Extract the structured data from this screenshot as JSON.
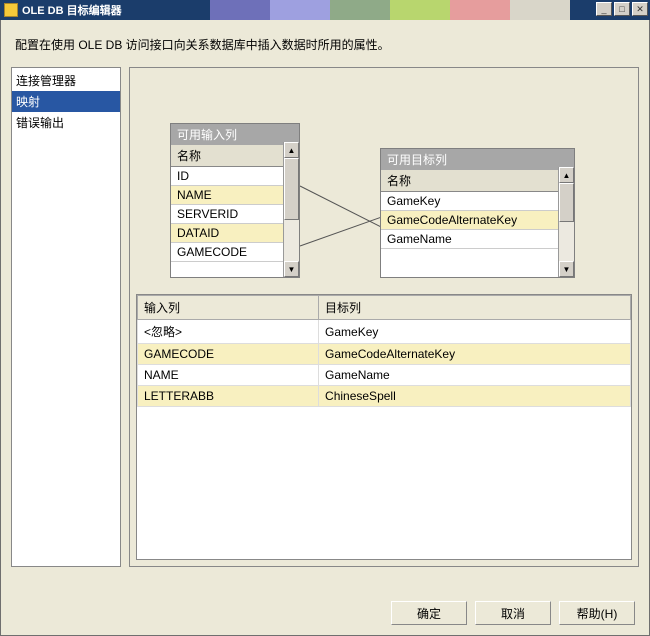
{
  "window": {
    "title": "OLE DB 目标编辑器"
  },
  "description": "配置在使用 OLE DB 访问接口向关系数据库中插入数据时所用的属性。",
  "nav": {
    "items": [
      {
        "label": "连接管理器",
        "selected": false
      },
      {
        "label": "映射",
        "selected": true
      },
      {
        "label": "错误输出",
        "selected": false
      }
    ]
  },
  "input_box": {
    "title": "可用输入列",
    "header": "名称",
    "rows": [
      {
        "label": "ID",
        "hl": false
      },
      {
        "label": "NAME",
        "hl": true
      },
      {
        "label": "SERVERID",
        "hl": false
      },
      {
        "label": "DATAID",
        "hl": true
      },
      {
        "label": "GAMECODE",
        "hl": false
      }
    ]
  },
  "target_box": {
    "title": "可用目标列",
    "header": "名称",
    "rows": [
      {
        "label": "GameKey",
        "hl": false
      },
      {
        "label": "GameCodeAlternateKey",
        "hl": true
      },
      {
        "label": "GameName",
        "hl": false
      }
    ]
  },
  "map_table": {
    "cols": [
      "输入列",
      "目标列"
    ],
    "rows": [
      {
        "in": "<忽略>",
        "out": "GameKey",
        "hl": false
      },
      {
        "in": "GAMECODE",
        "out": "GameCodeAlternateKey",
        "hl": true
      },
      {
        "in": "NAME",
        "out": "GameName",
        "hl": false
      },
      {
        "in": "LETTERABB",
        "out": "ChineseSpell",
        "hl": true
      }
    ]
  },
  "buttons": {
    "ok": "确定",
    "cancel": "取消",
    "help": "帮助(H)"
  }
}
